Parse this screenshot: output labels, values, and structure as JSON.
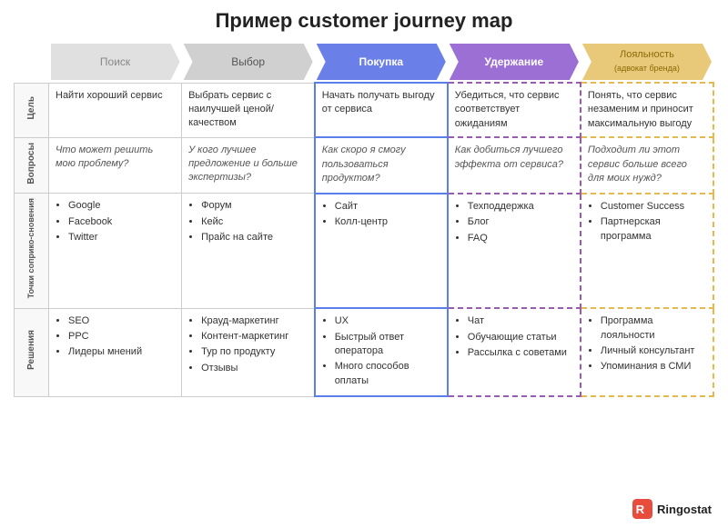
{
  "title": "Пример customer journey map",
  "stages": [
    {
      "label": "Поиск",
      "color": "#e0e0e0",
      "textColor": "#888",
      "active": false
    },
    {
      "label": "Выбор",
      "color": "#d0d0d0",
      "textColor": "#666",
      "active": false
    },
    {
      "label": "Покупка",
      "color": "#6b7fe8",
      "textColor": "#fff",
      "active": true
    },
    {
      "label": "Удержание",
      "color": "#9b6fd4",
      "textColor": "#fff",
      "active": true
    },
    {
      "label": "Лояльность",
      "sublabel": "(адвокат бренда)",
      "color": "#e8c97a",
      "textColor": "#8a6a00",
      "active": false
    }
  ],
  "rows": [
    {
      "label": "Цель",
      "cells": [
        {
          "text": "Найти хороший сервис",
          "type": "plain"
        },
        {
          "text": "Выбрать сервис с наилучшей ценой/качеством",
          "type": "plain"
        },
        {
          "text": "Начать получать выгоду от сервиса",
          "type": "highlight-blue"
        },
        {
          "text": "Убедиться, что сервис соответствует ожиданиям",
          "type": "highlight-purple"
        },
        {
          "text": "Понять, что сервис незаменим и приносит максимальную выгоду",
          "type": "highlight-orange"
        }
      ]
    },
    {
      "label": "Вопросы",
      "cells": [
        {
          "text": "Что может решить мою проблему?",
          "type": "italic"
        },
        {
          "text": "У кого лучшее предложение и больше экспертизы?",
          "type": "italic"
        },
        {
          "text": "Как скоро я смогу пользоваться продуктом?",
          "type": "italic highlight-blue"
        },
        {
          "text": "Как добиться лучшего эффекта от сервиса?",
          "type": "italic highlight-purple"
        },
        {
          "text": "Подходит ли этот сервис больше всего для моих нужд?",
          "type": "italic highlight-orange"
        }
      ]
    },
    {
      "label": "Точки сопри-косно-вения",
      "cells": [
        {
          "list": [
            "Google",
            "Facebook",
            "Twitter"
          ],
          "type": "plain"
        },
        {
          "list": [
            "Форум",
            "Кейс",
            "Прайс на сайте"
          ],
          "type": "plain"
        },
        {
          "list": [
            "Сайт",
            "Колл-центр"
          ],
          "type": "highlight-blue"
        },
        {
          "list": [
            "Техподдержка",
            "Блог",
            "FAQ"
          ],
          "type": "highlight-purple"
        },
        {
          "list": [
            "Customer Success",
            "Партнерская программа"
          ],
          "type": "highlight-orange"
        }
      ]
    },
    {
      "label": "Решения",
      "cells": [
        {
          "list": [
            "SEO",
            "PPC",
            "Лидеры мнений"
          ],
          "type": "plain"
        },
        {
          "list": [
            "Крауд-маркетинг",
            "Контент-маркетинг",
            "Тур по продукту",
            "Отзывы"
          ],
          "type": "plain"
        },
        {
          "list": [
            "UX",
            "Быстрый ответ оператора",
            "Много способов оплаты"
          ],
          "type": "highlight-blue"
        },
        {
          "list": [
            "Чат",
            "Обучающие статьи",
            "Рассылка с советами"
          ],
          "type": "highlight-purple"
        },
        {
          "list": [
            "Программа лояльности",
            "Личный консультант",
            "Упоминания в СМИ"
          ],
          "type": "highlight-orange"
        }
      ]
    }
  ],
  "logo": {
    "text": "Ringostat",
    "icon_color": "#e74c3c"
  }
}
